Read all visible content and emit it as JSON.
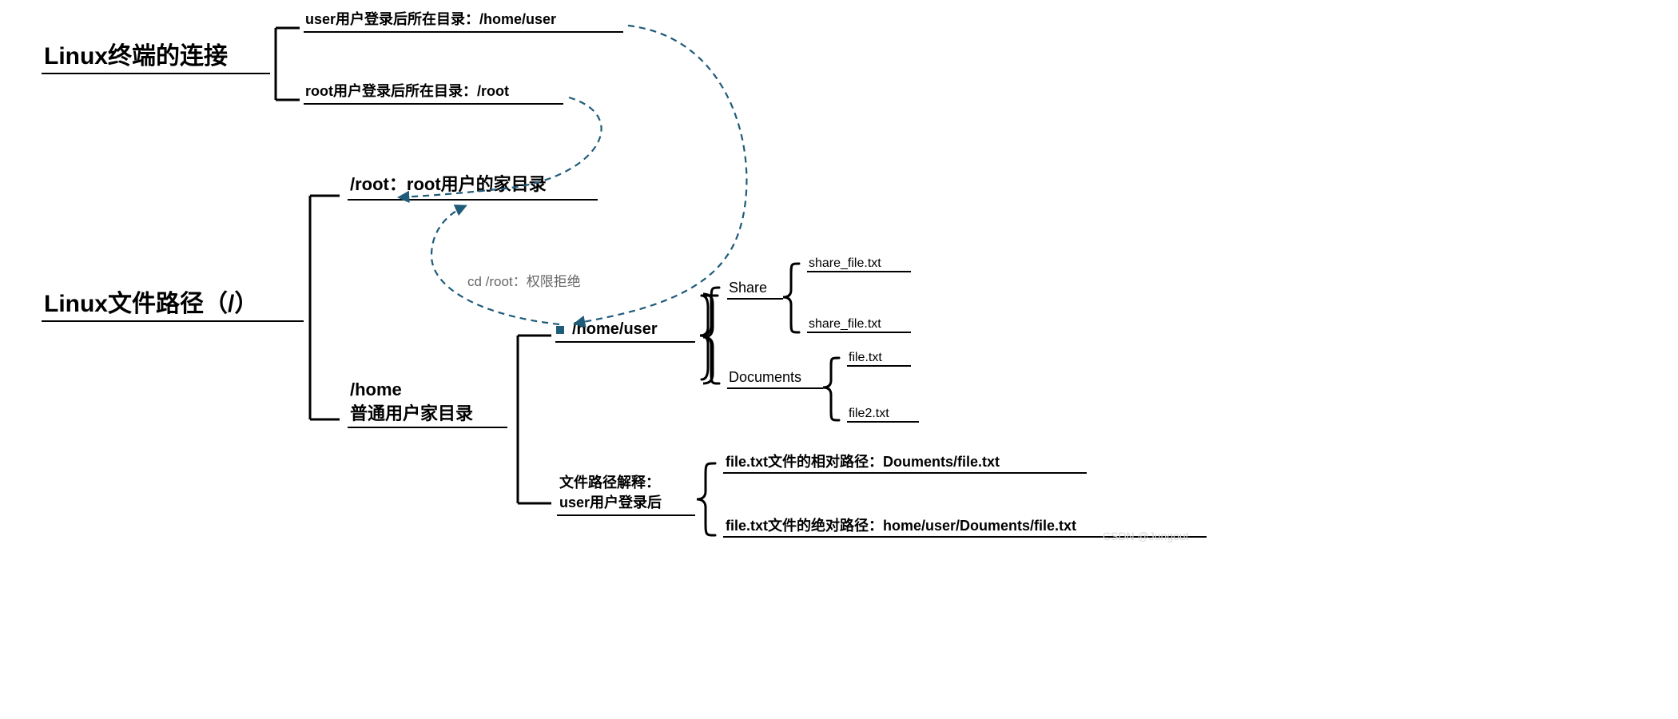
{
  "root1": {
    "title": "Linux终端的连接"
  },
  "root2": {
    "title": "Linux文件路径（/）"
  },
  "conn": {
    "user": "user用户登录后所在目录：/home/user",
    "root": "root用户登录后所在目录：/root"
  },
  "fs": {
    "root_home": "/root：root用户的家目录",
    "home_line1": "/home",
    "home_line2": "普通用户家目录",
    "cd_denied": "cd /root：权限拒绝",
    "home_user": "/home/user",
    "share": "Share",
    "share_f1": "share_file.txt",
    "share_f2": "share_file.txt",
    "docs": "Documents",
    "docs_f1": "file.txt",
    "docs_f2": "file2.txt",
    "explain1": "文件路径解释：",
    "explain2": "user用户登录后",
    "rel": "file.txt文件的相对路径：Douments/file.txt",
    "abs": "file.txt文件的绝对路径：home/user/Douments/file.txt"
  },
  "watermark": "CSDN @Jungout",
  "colors": {
    "arrow": "#1f5b7a"
  }
}
